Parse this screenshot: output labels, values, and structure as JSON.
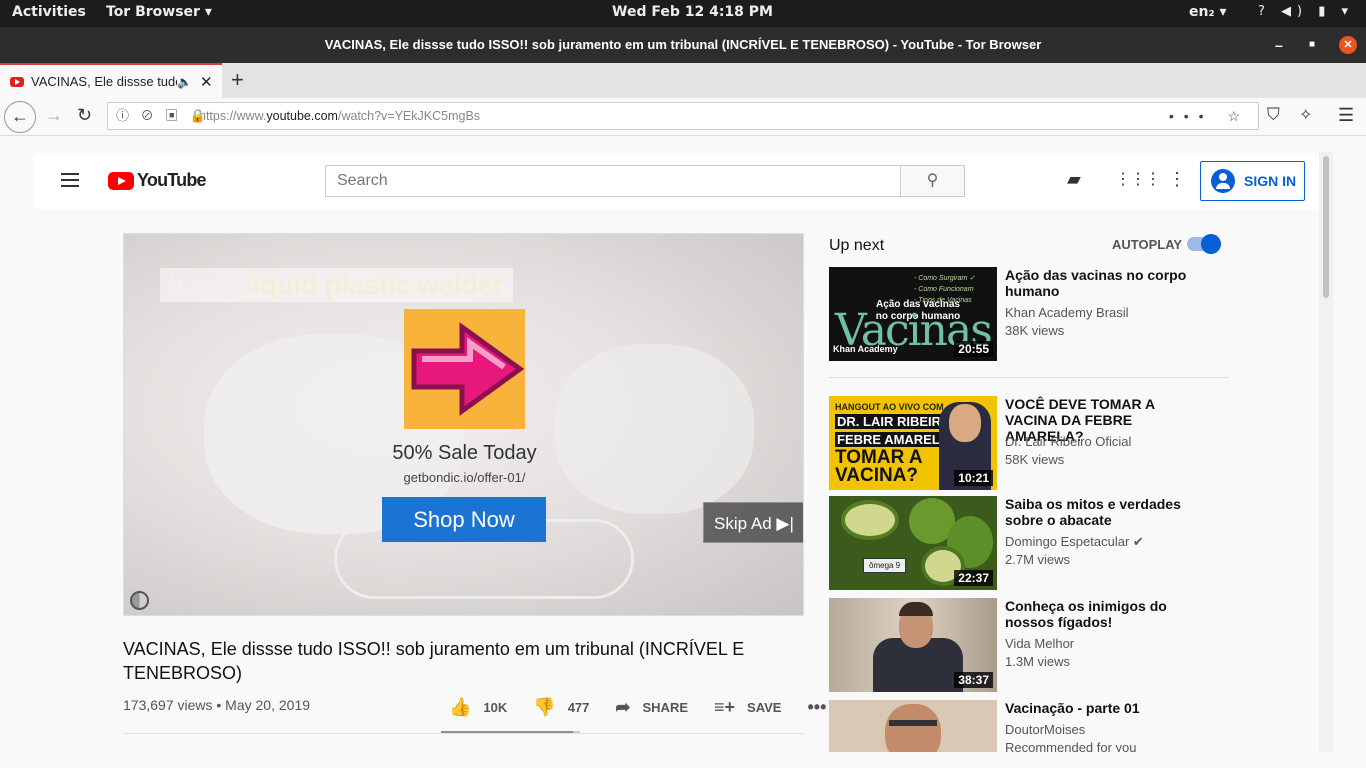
{
  "gnome": {
    "activities": "Activities",
    "app": "Tor Browser ▾",
    "clock": "Wed Feb 12   4:18 PM",
    "lang": "en₂ ▾",
    "tray": "? ◀) ▮ ▾"
  },
  "window": {
    "title": "VACINAS, Ele dissse tudo ISSO!! sob juramento em um tribunal (INCRÍVEL E TENEBROSO) - YouTube - Tor Browser"
  },
  "tab": {
    "title": "VACINAS, Ele dissse tudo",
    "close": "✕",
    "new": "+"
  },
  "url": {
    "prefix": "https://www.",
    "domain": "youtube.com",
    "path": "/watch?v=YEkJKC5mgBs"
  },
  "yt": {
    "logo": "YouTube",
    "search_placeholder": "Search",
    "sign_in": "SIGN IN",
    "ad": {
      "caption_white": "It is a ",
      "caption_yellow": "liquid plastic welder",
      "title": "50% Sale Today",
      "url": "getbondic.io/offer-01/",
      "cta": "Shop Now",
      "skip": "Skip Ad ▶|"
    },
    "video": {
      "title": "VACINAS, Ele dissse tudo ISSO!! sob juramento em um tribunal (INCRÍVEL E TENEBROSO)",
      "meta": "173,697 views • May 20, 2019",
      "likes": "10K",
      "dislikes": "477",
      "share": "SHARE",
      "save": "SAVE",
      "like_ratio": 0.95
    },
    "upnext": "Up next",
    "autoplay": "AUTOPLAY",
    "recs": [
      {
        "title": "Ação das vacinas no corpo humano",
        "channel": "Khan Academy Brasil",
        "views": "38K views",
        "duration": "20:55",
        "thumb_text": "Ação das vacinas no corpo humano",
        "thumb_big": "Vacinas",
        "thumb_brand": "Khan Academy",
        "thumb_notes": "- Como Surgiram ✓\n- Como Funcionam\n- Tipos de Vacinas"
      },
      {
        "title": "VOCÊ DEVE TOMAR A VACINA DA FEBRE AMARELA?",
        "channel": "Dr. Lair Ribeiro Oficial",
        "views": "58K views",
        "duration": "10:21",
        "thumb_l1": "HANGOUT AO VIVO COM",
        "thumb_l2": "DR. LAIR RIBEIRO",
        "thumb_l3": "FEBRE AMARELA",
        "thumb_l4": "TOMAR A",
        "thumb_l5": "VACINA?"
      },
      {
        "title": "Saiba os mitos e verdades sobre o abacate",
        "channel": "Domingo Espetacular ✔",
        "views": "2.7M views",
        "duration": "22:37",
        "thumb_label": "ômega 9"
      },
      {
        "title": "Conheça os inimigos do nossos fígados!",
        "channel": "Vida Melhor",
        "views": "1.3M views",
        "duration": "38:37"
      },
      {
        "title": "Vacinação - parte 01",
        "channel": "DoutorMoises",
        "views": "Recommended for you"
      }
    ]
  }
}
